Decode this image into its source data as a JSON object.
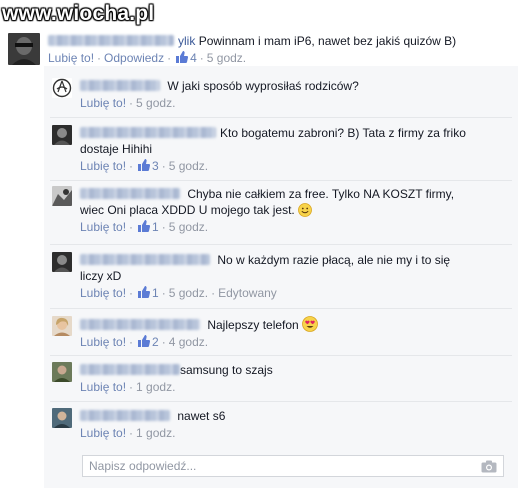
{
  "watermark": "www.wiocha.pl",
  "like_label": "Lubię to!",
  "reply_label": "Odpowiedz",
  "sep": "·",
  "comments": [
    {
      "name_tail": "ylik",
      "text": "Powinnam i mam iP6, nawet bez jakiś quizów B)",
      "likes": "4",
      "time": "5 godz."
    },
    {
      "text": "W jaki sposób wyprosiłaś rodziców?",
      "time": "5 godz."
    },
    {
      "text1": "Kto bogatemu zabroni? B) Tata z firmy za friko",
      "text2": "dostaje Hihihi",
      "likes": "3",
      "time": "5 godz."
    },
    {
      "text1": "Chyba nie całkiem za free. Tylko NA KOSZT firmy,",
      "text2": "wiec Oni placa XDDD U mojego tak jest.",
      "likes": "1",
      "time": "5 godz."
    },
    {
      "text1": "No w każdym razie płacą, ale nie my i to się",
      "text2": "liczy xD",
      "likes": "1",
      "time": "5 godz.",
      "edited": "Edytowany"
    },
    {
      "text": "Najlepszy telefon",
      "likes": "2",
      "time": "4 godz."
    },
    {
      "text": "samsung to szajs",
      "time": "1 godz."
    },
    {
      "text": "nawet s6",
      "time": "1 godz."
    }
  ],
  "reply_box": {
    "placeholder": "Napisz odpowiedź..."
  },
  "colors": {
    "link": "#6d84b4",
    "meta": "#9197a3",
    "reply_bg": "#f6f7f9"
  }
}
